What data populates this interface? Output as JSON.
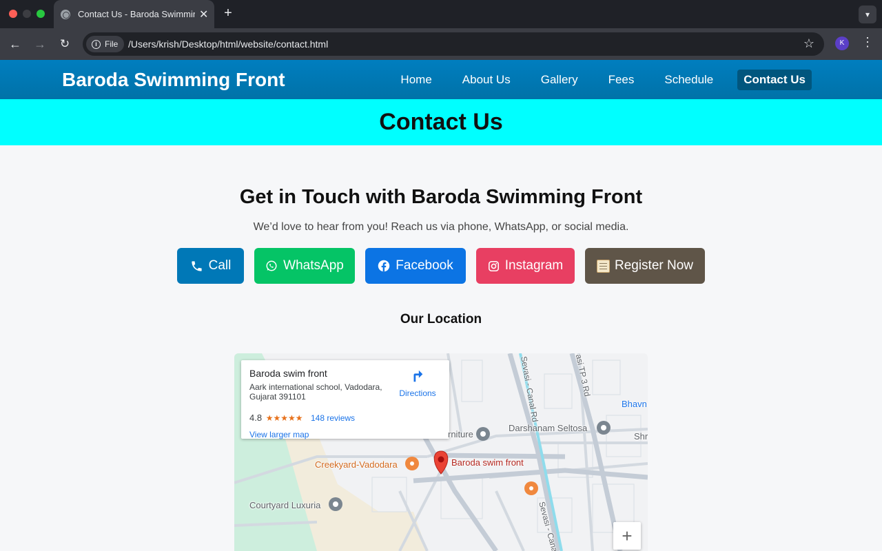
{
  "browser": {
    "tab_title": "Contact Us - Baroda Swimming Front",
    "chip_label": "File",
    "url": "/Users/krish/Desktop/html/website/contact.html",
    "profile_initial": "K"
  },
  "site": {
    "brand": "Baroda Swimming Front",
    "nav": [
      "Home",
      "About Us",
      "Gallery",
      "Fees",
      "Schedule",
      "Contact Us"
    ],
    "active_nav": "Contact Us"
  },
  "banner": {
    "title": "Contact Us"
  },
  "main": {
    "headline": "Get in Touch with Baroda Swimming Front",
    "subtitle": "We’d love to hear from you! Reach us via phone, WhatsApp, or social media.",
    "buttons": {
      "call": "Call",
      "whatsapp": "WhatsApp",
      "facebook": "Facebook",
      "instagram": "Instagram",
      "register": "Register Now"
    },
    "location_title": "Our Location"
  },
  "map": {
    "place_name": "Baroda swim front",
    "address": "Aark international school, Vadodara, Gujarat 391101",
    "rating": "4.8",
    "stars": "★★★★★",
    "reviews": "148 reviews",
    "view_larger": "View larger map",
    "directions": "Directions",
    "labels": {
      "furniture": "rniture",
      "darshanam": "Darshanam Seltosa",
      "creekyard": "Creekyard-Vadodara",
      "pin": "Baroda swim front",
      "courtyard": "Courtyard Luxuria",
      "bhavn": "Bhavn",
      "shr": "Shr",
      "canal_rd_top": "Sevasi - Canal Rd",
      "tp3": "asi TP 3 Rd",
      "canal_rd_bottom": "Sevasi - Cana"
    },
    "zoom_in": "+"
  },
  "colors": {
    "header": "#0078b7",
    "banner": "#00ffff",
    "call": "#0078b7",
    "whatsapp": "#05c466",
    "facebook": "#0c74e4",
    "instagram": "#e83f62",
    "register": "#5f5548"
  }
}
